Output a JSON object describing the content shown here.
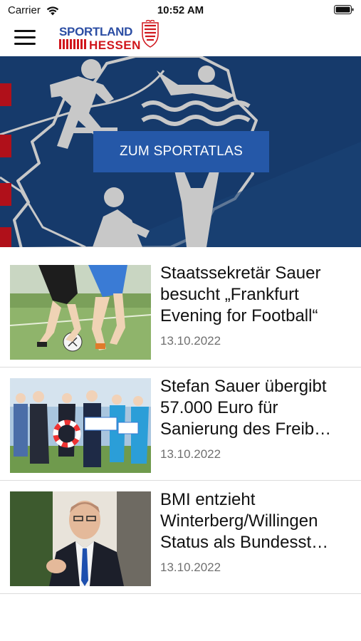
{
  "status_bar": {
    "carrier": "Carrier",
    "time": "10:52 AM",
    "wifi_icon": "wifi-icon",
    "battery_icon": "battery-icon"
  },
  "nav": {
    "menu_icon": "hamburger-menu-icon",
    "logo_alt": "Sportland Hessen logo",
    "logo_line1": "SPORTLAND",
    "logo_line2": "HESSEN"
  },
  "hero": {
    "button_label": "ZUM SPORTATLAS",
    "colors": {
      "background": "#163a6b",
      "button": "#2558a8",
      "figures": "#c8c8c8",
      "accent_red": "#b0101a"
    }
  },
  "news": [
    {
      "title_lines": [
        "Staatssekretär Sauer",
        "besucht „Frankfurt",
        "Evening for Football“"
      ],
      "date": "13.10.2022",
      "thumbnail": "football-players-photo"
    },
    {
      "title_lines": [
        "Stefan Sauer übergibt",
        "57.000 Euro für",
        "Sanierung des Freib…"
      ],
      "date": "13.10.2022",
      "thumbnail": "group-check-handover-photo"
    },
    {
      "title_lines": [
        "BMI entzieht",
        "Winterberg/Willingen",
        "Status als Bundesst…"
      ],
      "date": "13.10.2022",
      "thumbnail": "politician-portrait-photo"
    }
  ]
}
